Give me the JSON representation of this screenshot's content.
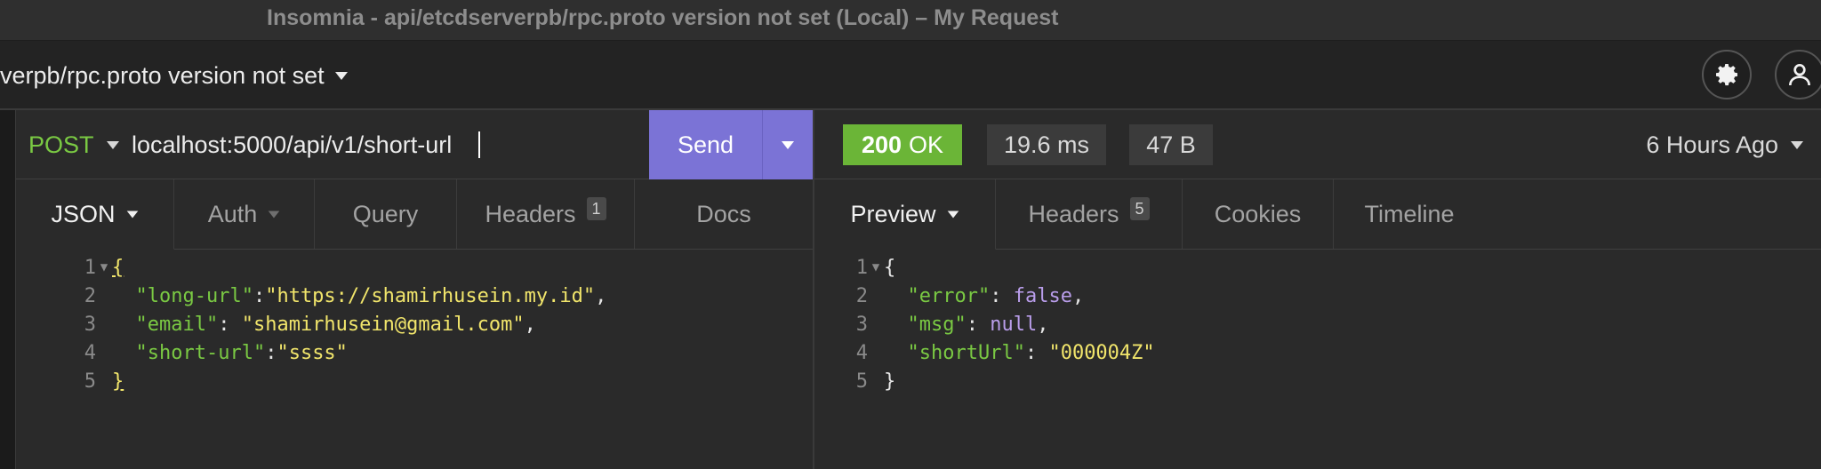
{
  "window": {
    "title": "Insomnia - api/etcdserverpb/rpc.proto version not set (Local) – My Request"
  },
  "topbar": {
    "project_label": "verpb/rpc.proto version not set",
    "settings_icon": "gear-icon",
    "account_icon": "user-icon"
  },
  "request": {
    "method": "POST",
    "url": "localhost:5000/api/v1/short-url",
    "send_label": "Send",
    "tabs": [
      {
        "label": "JSON",
        "badge": ""
      },
      {
        "label": "Auth",
        "badge": ""
      },
      {
        "label": "Query",
        "badge": ""
      },
      {
        "label": "Headers",
        "badge": "1"
      },
      {
        "label": "Docs",
        "badge": ""
      }
    ],
    "body_lines": [
      {
        "n": "1",
        "text": "{"
      },
      {
        "n": "2",
        "key": "\"long-url\"",
        "sep": ":",
        "value": "\"https://shamirhusein.my.id\"",
        "tail": ","
      },
      {
        "n": "3",
        "key": "\"email\"",
        "sep": ": ",
        "value": "\"shamirhusein@gmail.com\"",
        "tail": ","
      },
      {
        "n": "4",
        "key": "\"short-url\"",
        "sep": ":",
        "value": "\"ssss\"",
        "tail": ""
      },
      {
        "n": "5",
        "text": "}"
      }
    ]
  },
  "response": {
    "status_code": "200",
    "status_text": "OK",
    "time": "19.6 ms",
    "size": "47 B",
    "time_ago": "6 Hours Ago",
    "tabs": [
      {
        "label": "Preview",
        "badge": ""
      },
      {
        "label": "Headers",
        "badge": "5"
      },
      {
        "label": "Cookies",
        "badge": ""
      },
      {
        "label": "Timeline",
        "badge": ""
      }
    ],
    "body_lines": [
      {
        "n": "1",
        "text": "{"
      },
      {
        "n": "2",
        "key": "\"error\"",
        "sep": ": ",
        "value": "false",
        "tail": ","
      },
      {
        "n": "3",
        "key": "\"msg\"",
        "sep": ": ",
        "value": "null",
        "tail": ","
      },
      {
        "n": "4",
        "key": "\"shortUrl\"",
        "sep": ": ",
        "value": "\"000004Z\"",
        "tail": ""
      },
      {
        "n": "5",
        "text": "}"
      }
    ]
  },
  "colors": {
    "accent": "#7b73d6",
    "method_green": "#7ac943",
    "status_ok": "#6bb537",
    "string_yellow": "#f1e56b",
    "keyword_purple": "#b99dea"
  }
}
